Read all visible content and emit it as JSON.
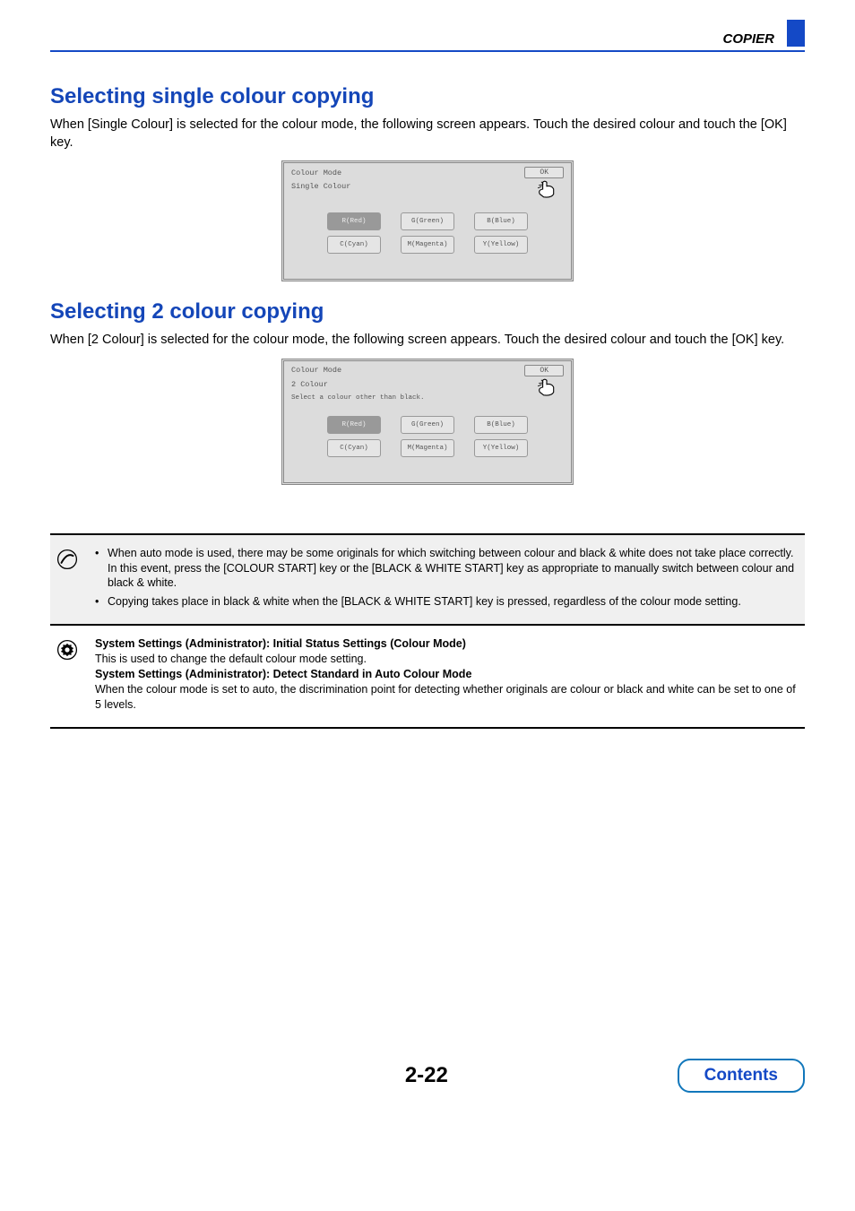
{
  "chapter": {
    "title": "COPIER"
  },
  "section1": {
    "heading": "Selecting single colour copying",
    "intro": "When [Single Colour] is selected for the colour mode, the following screen appears. Touch the desired colour and touch the [OK] key."
  },
  "section2": {
    "heading": "Selecting 2 colour copying",
    "intro": "When [2 Colour] is selected for the colour mode, the following screen appears. Touch the desired colour and touch the [OK] key."
  },
  "screen1": {
    "title": "Colour Mode",
    "ok": "OK",
    "subtitle": "Single Colour",
    "buttons_row1": [
      "R(Red)",
      "G(Green)",
      "B(Blue)"
    ],
    "buttons_row2": [
      "C(Cyan)",
      "M(Magenta)",
      "Y(Yellow)"
    ],
    "selected": "R(Red)"
  },
  "screen2": {
    "title": "Colour Mode",
    "ok": "OK",
    "subtitle": "2 Colour",
    "instruction": "Select a colour other than black.",
    "buttons_row1": [
      "R(Red)",
      "G(Green)",
      "B(Blue)"
    ],
    "buttons_row2": [
      "C(Cyan)",
      "M(Magenta)",
      "Y(Yellow)"
    ],
    "selected": "R(Red)"
  },
  "notes": {
    "bullet1": "When auto mode is used, there may be some originals for which switching between colour and black & white does not take place correctly. In this event, press the [COLOUR START] key or the [BLACK & WHITE START] key as appropriate to manually switch between colour and black & white.",
    "bullet2": "Copying takes place in black & white when the [BLACK & WHITE START] key is pressed, regardless of the colour mode setting."
  },
  "admin": {
    "line1b": "System Settings (Administrator): Initial Status Settings (Colour Mode)",
    "line1": "This is used to change the default colour mode setting.",
    "line2b": "System Settings (Administrator): Detect Standard in Auto Colour Mode",
    "line2": "When the colour mode is set to auto, the discrimination point for detecting whether originals are colour or black and white can be set to one of 5 levels."
  },
  "footer": {
    "page": "2-22",
    "contents": "Contents"
  }
}
